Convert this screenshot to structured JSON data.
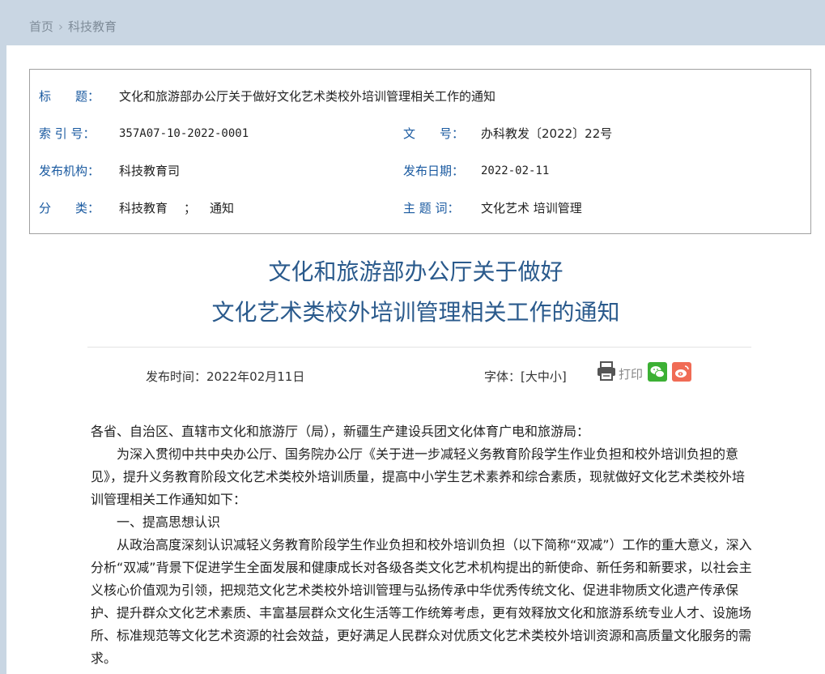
{
  "breadcrumb": {
    "home": "首页",
    "separator": "›",
    "current": "科技教育"
  },
  "meta": {
    "title_label": "标　　题：",
    "title_value": "文化和旅游部办公厅关于做好文化艺术类校外培训管理相关工作的通知",
    "index_label": "索 引 号：",
    "index_value": "357A07-10-2022-0001",
    "docno_label": "文　　号：",
    "docno_value": "办科教发〔2022〕22号",
    "org_label": "发布机构：",
    "org_value": "科技教育司",
    "date_label": "发布日期：",
    "date_value": "2022-02-11",
    "category_label": "分　　类：",
    "category_value_1": "科技教育",
    "category_sep": "；",
    "category_value_2": "通知",
    "keywords_label": "主 题 词：",
    "keywords_value": "文化艺术 培训管理"
  },
  "article": {
    "title_line1": "文化和旅游部办公厅关于做好",
    "title_line2": "文化艺术类校外培训管理相关工作的通知",
    "publish_time": "发布时间：2022年02月11日",
    "font_size_label": "字体：[大中小]",
    "print_label": "打印",
    "paragraphs": [
      "各省、自治区、直辖市文化和旅游厅（局），新疆生产建设兵团文化体育广电和旅游局：",
      "为深入贯彻中共中央办公厅、国务院办公厅《关于进一步减轻义务教育阶段学生作业负担和校外培训负担的意见》，提升义务教育阶段文化艺术类校外培训质量，提高中小学生艺术素养和综合素质，现就做好文化艺术类校外培训管理相关工作通知如下：",
      "一、提高思想认识",
      "从政治高度深刻认识减轻义务教育阶段学生作业负担和校外培训负担（以下简称“双减”）工作的重大意义，深入分析“双减”背景下促进学生全面发展和健康成长对各级各类文化艺术机构提出的新使命、新任务和新要求，以社会主义核心价值观为引领，把规范文化艺术类校外培训管理与弘扬传承中华优秀传统文化、促进非物质文化遗产传承保护、提升群众文化艺术素质、丰富基层群众文化生活等工作统筹考虑，更有效释放文化和旅游系统专业人才、设施场所、标准规范等文化艺术资源的社会效益，更好满足人民群众对优质文化艺术类校外培训资源和高质量文化服务的需求。"
    ]
  },
  "icons": {
    "print": "printer-icon",
    "wechat": "wechat-icon",
    "weibo": "weibo-icon"
  },
  "colors": {
    "label_blue": "#1a5aa0",
    "title_blue": "#2a5a8c",
    "wechat_green": "#3cb034",
    "weibo_red": "#f06b55"
  }
}
